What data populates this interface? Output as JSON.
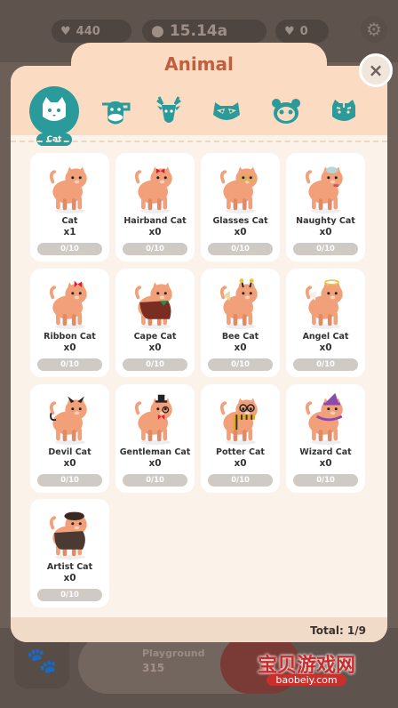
{
  "hud": {
    "hearts": "440",
    "money": "15.14a",
    "gems": "0"
  },
  "panel": {
    "title": "Animal",
    "close_label": "×",
    "active_tab_label": "Cat",
    "total": "Total: 1/9"
  },
  "tabs": [
    {
      "name": "cat",
      "icon": "cat-face-icon",
      "active": true
    },
    {
      "name": "cow",
      "icon": "cow-face-icon"
    },
    {
      "name": "deer",
      "icon": "deer-face-icon"
    },
    {
      "name": "raccoon",
      "icon": "raccoon-face-icon"
    },
    {
      "name": "panda",
      "icon": "panda-face-icon"
    },
    {
      "name": "tiger",
      "icon": "tiger-face-icon"
    }
  ],
  "animals": [
    {
      "name": "Cat",
      "count": "x1",
      "progress": "0/10",
      "accessory": "none"
    },
    {
      "name": "Hairband Cat",
      "count": "x0",
      "progress": "0/10",
      "accessory": "bow"
    },
    {
      "name": "Glasses Cat",
      "count": "x0",
      "progress": "0/10",
      "accessory": "glasses"
    },
    {
      "name": "Naughty Cat",
      "count": "x0",
      "progress": "0/10",
      "accessory": "cap"
    },
    {
      "name": "Ribbon Cat",
      "count": "x0",
      "progress": "0/10",
      "accessory": "ribbon"
    },
    {
      "name": "Cape Cat",
      "count": "x0",
      "progress": "0/10",
      "accessory": "cape"
    },
    {
      "name": "Bee Cat",
      "count": "x0",
      "progress": "0/10",
      "accessory": "antenna"
    },
    {
      "name": "Angel Cat",
      "count": "x0",
      "progress": "0/10",
      "accessory": "halo"
    },
    {
      "name": "Devil Cat",
      "count": "x0",
      "progress": "0/10",
      "accessory": "horns"
    },
    {
      "name": "Gentleman Cat",
      "count": "x0",
      "progress": "0/10",
      "accessory": "tophat"
    },
    {
      "name": "Potter Cat",
      "count": "x0",
      "progress": "0/10",
      "accessory": "scarf"
    },
    {
      "name": "Wizard Cat",
      "count": "x0",
      "progress": "0/10",
      "accessory": "wizard"
    },
    {
      "name": "Artist Cat",
      "count": "x0",
      "progress": "0/10",
      "accessory": "beret"
    }
  ],
  "bottom": {
    "label": "Playground",
    "value": "315"
  },
  "watermark": {
    "text": "宝贝游戏网",
    "url": "baobeiy.com"
  },
  "colors": {
    "teal": "#2a9a9a",
    "title": "#c05f40",
    "cat_body": "#f2a07a",
    "panel": "#fbf3ea"
  }
}
